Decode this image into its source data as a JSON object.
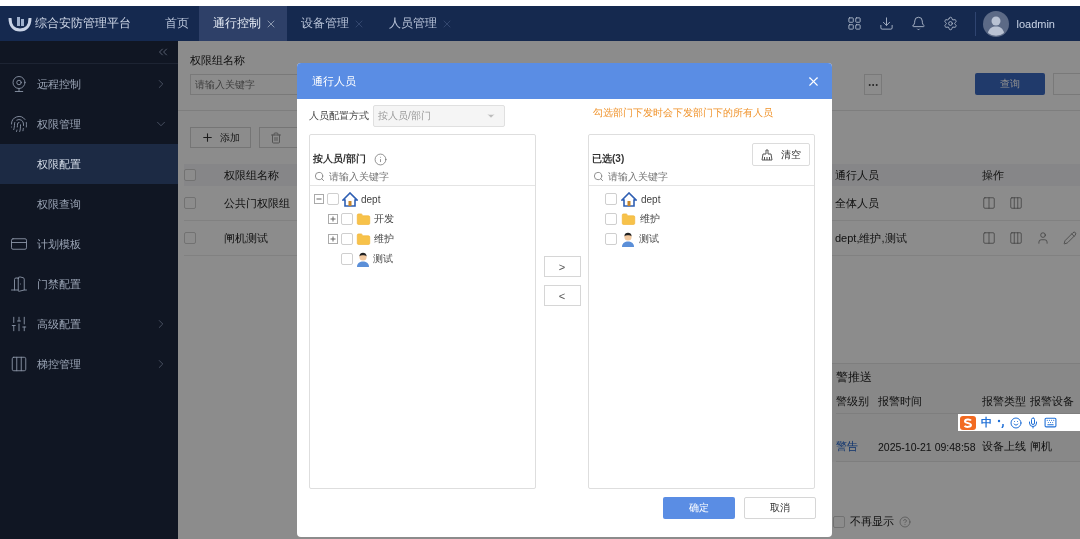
{
  "app": {
    "title": "综合安防管理平台"
  },
  "tabs": [
    {
      "label": "首页",
      "selected": false,
      "closable": false
    },
    {
      "label": "通行控制",
      "selected": true,
      "closable": true
    },
    {
      "label": "设备管理",
      "selected": false,
      "closable": true
    },
    {
      "label": "人员管理",
      "selected": false,
      "closable": true
    }
  ],
  "user": {
    "name": "loadmin"
  },
  "sidebar": {
    "items": [
      {
        "label": "远程控制",
        "selected": false,
        "expandable": true,
        "expanded": false
      },
      {
        "label": "权限管理",
        "selected": false,
        "expandable": true,
        "expanded": true,
        "children": [
          {
            "label": "权限配置",
            "selected": true
          },
          {
            "label": "权限查询",
            "selected": false
          }
        ]
      },
      {
        "label": "计划模板",
        "selected": false,
        "expandable": false
      },
      {
        "label": "门禁配置",
        "selected": false,
        "expandable": false
      },
      {
        "label": "高级配置",
        "selected": false,
        "expandable": true,
        "expanded": false
      },
      {
        "label": "梯控管理",
        "selected": false,
        "expandable": true,
        "expanded": false
      }
    ]
  },
  "filter": {
    "label": "权限组名称",
    "placeholder": "请输入关键字",
    "query_button": "查询"
  },
  "toolbar": {
    "add_button": "添加"
  },
  "table": {
    "all_checked": false,
    "columns": [
      "权限组名称",
      "通行人员",
      "操作"
    ],
    "rows": [
      {
        "name": "公共门权限组",
        "people": "全体人员",
        "checked": false,
        "person_actions": false
      },
      {
        "name": "闸机测试",
        "people": "dept,维护,测试",
        "checked": false,
        "person_actions": true
      }
    ]
  },
  "alarm": {
    "title": "警推送",
    "columns": [
      "警级别",
      "报警时间",
      "报警类型",
      "报警设备"
    ],
    "rows": [
      {
        "level": "警告",
        "time": "2025-10-21 09:48:58",
        "type": "设备上线",
        "device": "闸机"
      }
    ],
    "dont_show": {
      "label": "不再显示",
      "checked": false
    }
  },
  "dialog": {
    "title": "通行人员",
    "mode_label": "人员配置方式",
    "mode_value": "按人员/部门",
    "mode_disabled": true,
    "hint": "勾选部门下发时会下发部门下的所有人员",
    "left": {
      "title": "按人员/部门",
      "search_placeholder": "请输入关键字",
      "tree": [
        {
          "label": "dept",
          "kind": "dept",
          "checked": false,
          "expandable": true,
          "expanded": true,
          "children": [
            {
              "label": "开发",
              "kind": "folder",
              "checked": false,
              "expandable": true,
              "expanded": false
            },
            {
              "label": "维护",
              "kind": "folder",
              "checked": false,
              "expandable": true,
              "expanded": false
            },
            {
              "label": "测试",
              "kind": "person",
              "checked": false,
              "expandable": false
            }
          ]
        }
      ]
    },
    "transfer_buttons": [
      ">",
      "<"
    ],
    "right": {
      "title": "已选(3)",
      "clear_button": "清空",
      "search_placeholder": "请输入关键字",
      "items": [
        {
          "label": "dept",
          "kind": "dept",
          "checked": false
        },
        {
          "label": "维护",
          "kind": "folder",
          "checked": false
        },
        {
          "label": "测试",
          "kind": "person",
          "checked": false
        }
      ]
    },
    "ok_button": "确定",
    "cancel_button": "取消"
  },
  "ime": {
    "mode": "中"
  }
}
